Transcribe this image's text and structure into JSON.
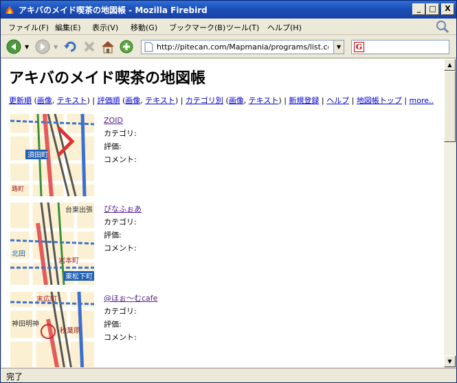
{
  "window": {
    "title": "アキバのメイド喫茶の地図帳 - Mozilla Firebird",
    "minimize": "_",
    "maximize": "□",
    "close": "X"
  },
  "menu": [
    "ファイル(F)",
    "編集(E)",
    "表示(V)",
    "移動(G)",
    "ブックマーク(B)",
    "ツール(T)",
    "ヘルプ(H)"
  ],
  "toolbar": {
    "url": "http://pitecan.com/Mapmania/programs/list.cgi?s",
    "search_value": ""
  },
  "page": {
    "title": "アキバのメイド喫茶の地図帳",
    "nav": {
      "sort_new": "更新順",
      "lparen1": " (",
      "image1": "画像",
      "comma1": ", ",
      "text1": "テキスト",
      "rparen1": ") | ",
      "sort_rating": "評価順",
      "lparen2": " (",
      "image2": "画像",
      "comma2": ", ",
      "text2": "テキスト",
      "rparen2": ") | ",
      "by_category": "カテゴリ別",
      "lparen3": " (",
      "image3": "画像",
      "comma3": ", ",
      "text3": "テキスト",
      "rparen3": ") | ",
      "register": "新規登録",
      "sep1": " | ",
      "help": "ヘルプ",
      "sep2": " | ",
      "top": "地図帳トップ",
      "sep3": " | ",
      "more": "more.."
    },
    "field_labels": {
      "category": "カテゴリ:",
      "rating": "評価:",
      "comment": "コメント:"
    },
    "entries": [
      {
        "name": "ZOID",
        "map_labels": [
          "須田町",
          "路町"
        ]
      },
      {
        "name": "ぴなふぉあ",
        "map_labels": [
          "台東出張",
          "岩本町",
          "東松下町",
          "北田"
        ]
      },
      {
        "name": "@ほぉ〜むcafe",
        "map_labels": [
          "末広町",
          "神田明神",
          "秋葉原"
        ]
      }
    ]
  },
  "status": "完了"
}
